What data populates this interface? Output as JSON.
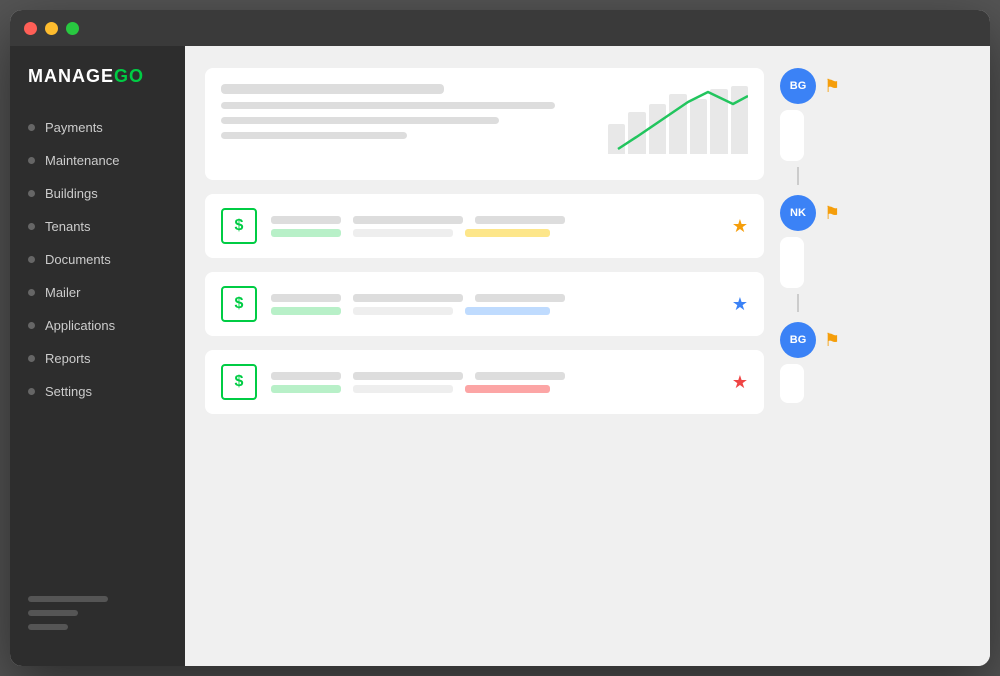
{
  "window": {
    "title": "ManageGo"
  },
  "logo": {
    "manage": "MANAGE",
    "go": "GO"
  },
  "sidebar": {
    "items": [
      {
        "label": "Payments",
        "id": "payments"
      },
      {
        "label": "Maintenance",
        "id": "maintenance"
      },
      {
        "label": "Buildings",
        "id": "buildings"
      },
      {
        "label": "Tenants",
        "id": "tenants"
      },
      {
        "label": "Documents",
        "id": "documents"
      },
      {
        "label": "Mailer",
        "id": "mailer"
      },
      {
        "label": "Applications",
        "id": "applications"
      },
      {
        "label": "Reports",
        "id": "reports"
      },
      {
        "label": "Settings",
        "id": "settings"
      }
    ]
  },
  "chart": {
    "bars": [
      30,
      45,
      55,
      65,
      60,
      70,
      75
    ],
    "linePoints": "10,65 30,52 55,35 80,18 100,8 125,20 140,12"
  },
  "list_items": [
    {
      "star_class": "star-orange",
      "star": "★",
      "color_bar": "green"
    },
    {
      "star_class": "star-blue",
      "star": "★",
      "color_bar": "blue"
    },
    {
      "star_class": "star-red",
      "star": "★",
      "color_bar": "red"
    }
  ],
  "timeline": [
    {
      "avatar": "BG",
      "flag": "⚑",
      "bars": [
        "80%",
        "60%",
        "90%"
      ]
    },
    {
      "avatar": "NK",
      "flag": "⚑",
      "bars": [
        "70%",
        "50%",
        "80%"
      ]
    },
    {
      "avatar": "BG",
      "flag": "⚑",
      "bars": [
        "75%",
        "55%",
        "85%"
      ]
    }
  ]
}
